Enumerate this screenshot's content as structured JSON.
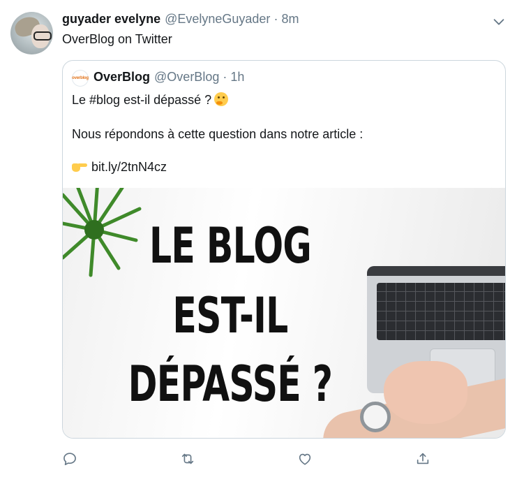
{
  "tweet": {
    "author_name": "guyader evelyne",
    "author_handle": "@EvelyneGuyader",
    "separator": "·",
    "timestamp": "8m",
    "text": "OverBlog on Twitter"
  },
  "quoted_tweet": {
    "avatar_text": "overblog",
    "author_name": "OverBlog",
    "author_handle": "@OverBlog",
    "separator": "·",
    "timestamp": "1h",
    "line1": "Le #blog est-il dépassé ?",
    "line2": "Nous répondons à cette question dans notre article :",
    "link": "bit.ly/2tnN4cz",
    "image": {
      "headline_line1": "LE BLOG",
      "headline_line2": "EST-IL",
      "headline_line3": "DÉPASSÉ ?"
    }
  },
  "icons": {
    "menu": "chevron-down-icon",
    "reply": "reply-icon",
    "retweet": "retweet-icon",
    "like": "like-icon",
    "share": "share-icon",
    "thinking": "thinking-face-emoji",
    "pointing": "pointing-right-emoji"
  },
  "colors": {
    "text": "#14171a",
    "secondary": "#657786",
    "border": "#ccd6dd",
    "brand_orange": "#e2741c"
  }
}
